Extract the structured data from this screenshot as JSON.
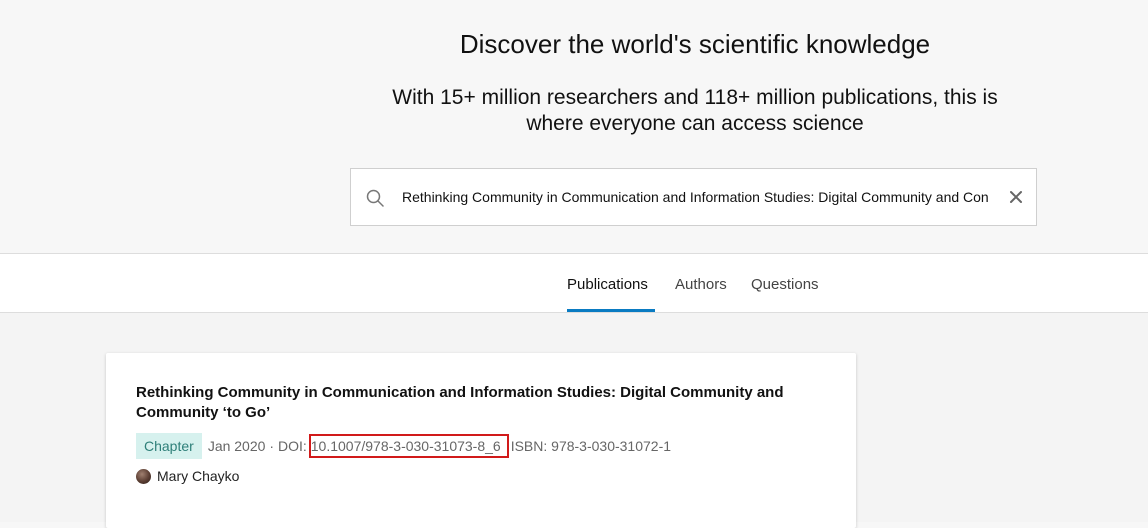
{
  "hero": {
    "title": "Discover the world's scientific knowledge",
    "subtitle_line1": "With 15+ million researchers and 118+ million publications, this is",
    "subtitle_line2": "where everyone can access science"
  },
  "search": {
    "value": "Rethinking Community in Communication and Information Studies: Digital Community and Con",
    "icon": "search-icon",
    "clear_icon": "close-icon"
  },
  "tabs": [
    {
      "label": "Publications",
      "active": true
    },
    {
      "label": "Authors",
      "active": false
    },
    {
      "label": "Questions",
      "active": false
    }
  ],
  "result": {
    "title_line1": "Rethinking Community in Communication and Information Studies: Digital Community and",
    "title_line2": "Community ‘to Go’",
    "type_badge": "Chapter",
    "date": "Jan 2020",
    "doi_label": "· DOI:",
    "doi_value": "10.1007/978-3-030-31073-8_6",
    "isbn": "ISBN: 978-3-030-31072-1",
    "author": "Mary Chayko"
  },
  "colors": {
    "accent": "#0a7bc2",
    "badge_bg": "#d6f1ee",
    "badge_text": "#2e7f79",
    "highlight_box": "#d11a1a"
  }
}
